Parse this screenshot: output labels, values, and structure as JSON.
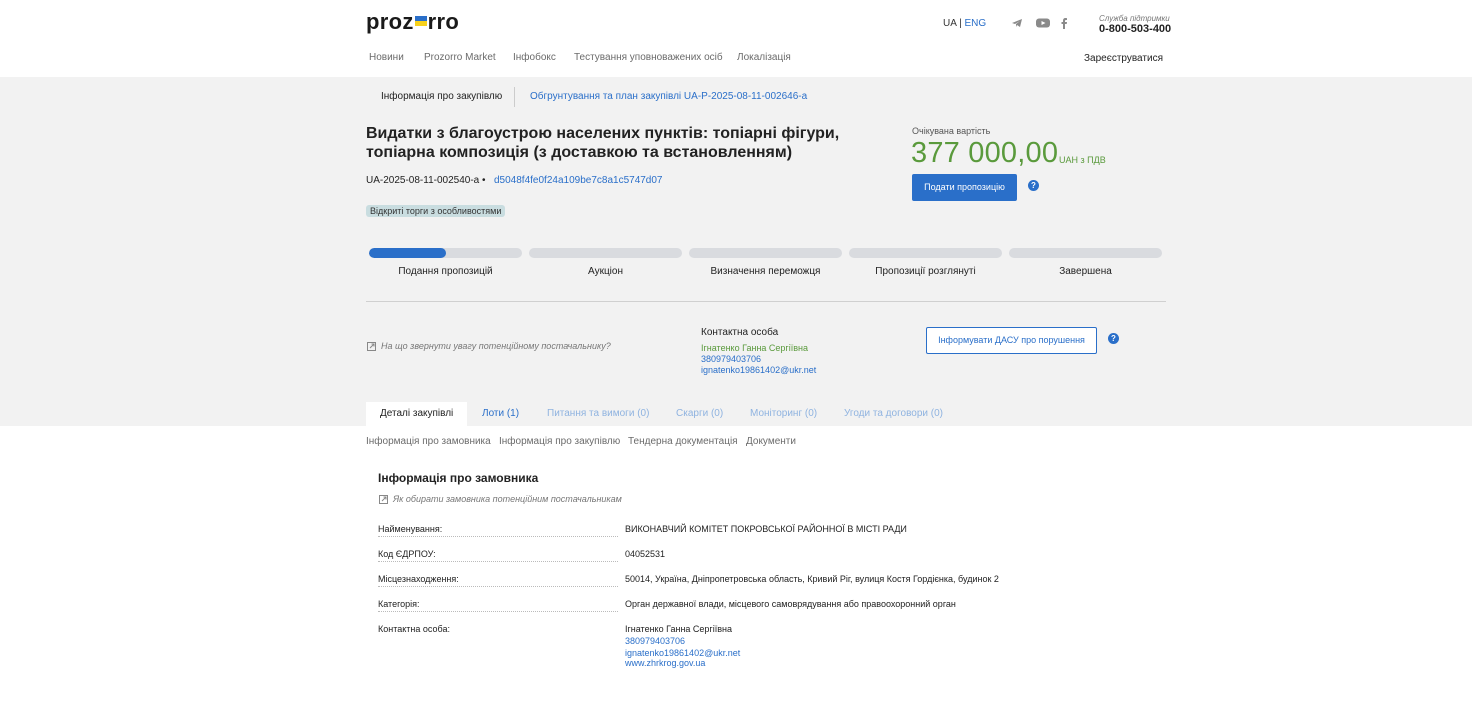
{
  "header": {
    "logo_left": "proz",
    "logo_right": "rro",
    "lang_ua": "UA",
    "lang_sep": "|",
    "lang_eng": "ENG",
    "support_label": "Служба підтримки",
    "support_phone": "0-800-503-400",
    "nav": [
      "Новини",
      "Prozorro Market",
      "Інфобокс",
      "Тестування уповноважених осіб",
      "Локалізація"
    ],
    "register": "Зареєструватися",
    "social_icons": [
      "telegram-icon",
      "youtube-icon",
      "facebook-icon"
    ]
  },
  "subtabs": {
    "info": "Інформація про закупівлю",
    "plan": "Обгрунтування та план закупівлі UA-P-2025-08-11-002646-a"
  },
  "tender": {
    "title": "Видатки з благоустрою населених пунктів: топіарні фігури, топіарна композиція (з доставкою та встановленням)",
    "id": "UA-2025-08-11-002540-a",
    "bullet": "•",
    "hash": "d5048f4fe0f24a109be7c8a1c5747d07",
    "procedure": "Відкриті торги з особливостями",
    "expected_label": "Очікувана вартість",
    "amount": "377 000,00",
    "currency": "UAH з ПДВ",
    "submit_button": "Подати пропозицію",
    "help_mark": "?"
  },
  "stages": [
    {
      "label": "Подання пропозицій",
      "progress": 0.5
    },
    {
      "label": "Аукціон",
      "progress": 0
    },
    {
      "label": "Визначення переможця",
      "progress": 0
    },
    {
      "label": "Пропозиції розглянуті",
      "progress": 0
    },
    {
      "label": "Завершена",
      "progress": 0
    }
  ],
  "contact": {
    "hint": "На що звернути увагу потенційному постачальнику?",
    "label": "Контактна особа",
    "name": "Ігнатенко Ганна Сергіївна",
    "phone": "380979403706",
    "email": "ignatenko19861402@ukr.net",
    "dasu_button": "Інформувати ДАСУ про порушення"
  },
  "tabs": [
    "Деталі закупівлі",
    "Лоти (1)",
    "Питання та вимоги (0)",
    "Скарги (0)",
    "Моніторинг (0)",
    "Угоди та договори (0)"
  ],
  "anchors": [
    "Інформація про замовника",
    "Інформація про закупівлю",
    "Тендерна документація",
    "Документи"
  ],
  "customer": {
    "title": "Інформація про замовника",
    "hint": "Як обирати замовника потенційним постачальникам",
    "rows": [
      {
        "label": "Найменування:",
        "value": "ВИКОНАВЧИЙ КОМІТЕТ ПОКРОВСЬКОЇ РАЙОННОЇ В МІСТІ РАДИ"
      },
      {
        "label": "Код ЄДРПОУ:",
        "value": "04052531"
      },
      {
        "label": "Місцезнаходження:",
        "value": "50014, Україна, Дніпропетровська область, Кривий Ріг, вулиця Костя Гордієнка, будинок 2"
      },
      {
        "label": "Категорія:",
        "value": "Орган державної влади, місцевого самоврядування або правоохоронний орган"
      },
      {
        "label": "Контактна особа:",
        "value": "Ігнатенко Ганна Сергіївна"
      }
    ],
    "contact_phone": "380979403706",
    "contact_email": "ignatenko19861402@ukr.net",
    "contact_site": "www.zhrkrog.gov.ua"
  },
  "colors": {
    "accent": "#2a6fc9",
    "amount": "#5a9a3c",
    "band": "#f2f2f2"
  }
}
